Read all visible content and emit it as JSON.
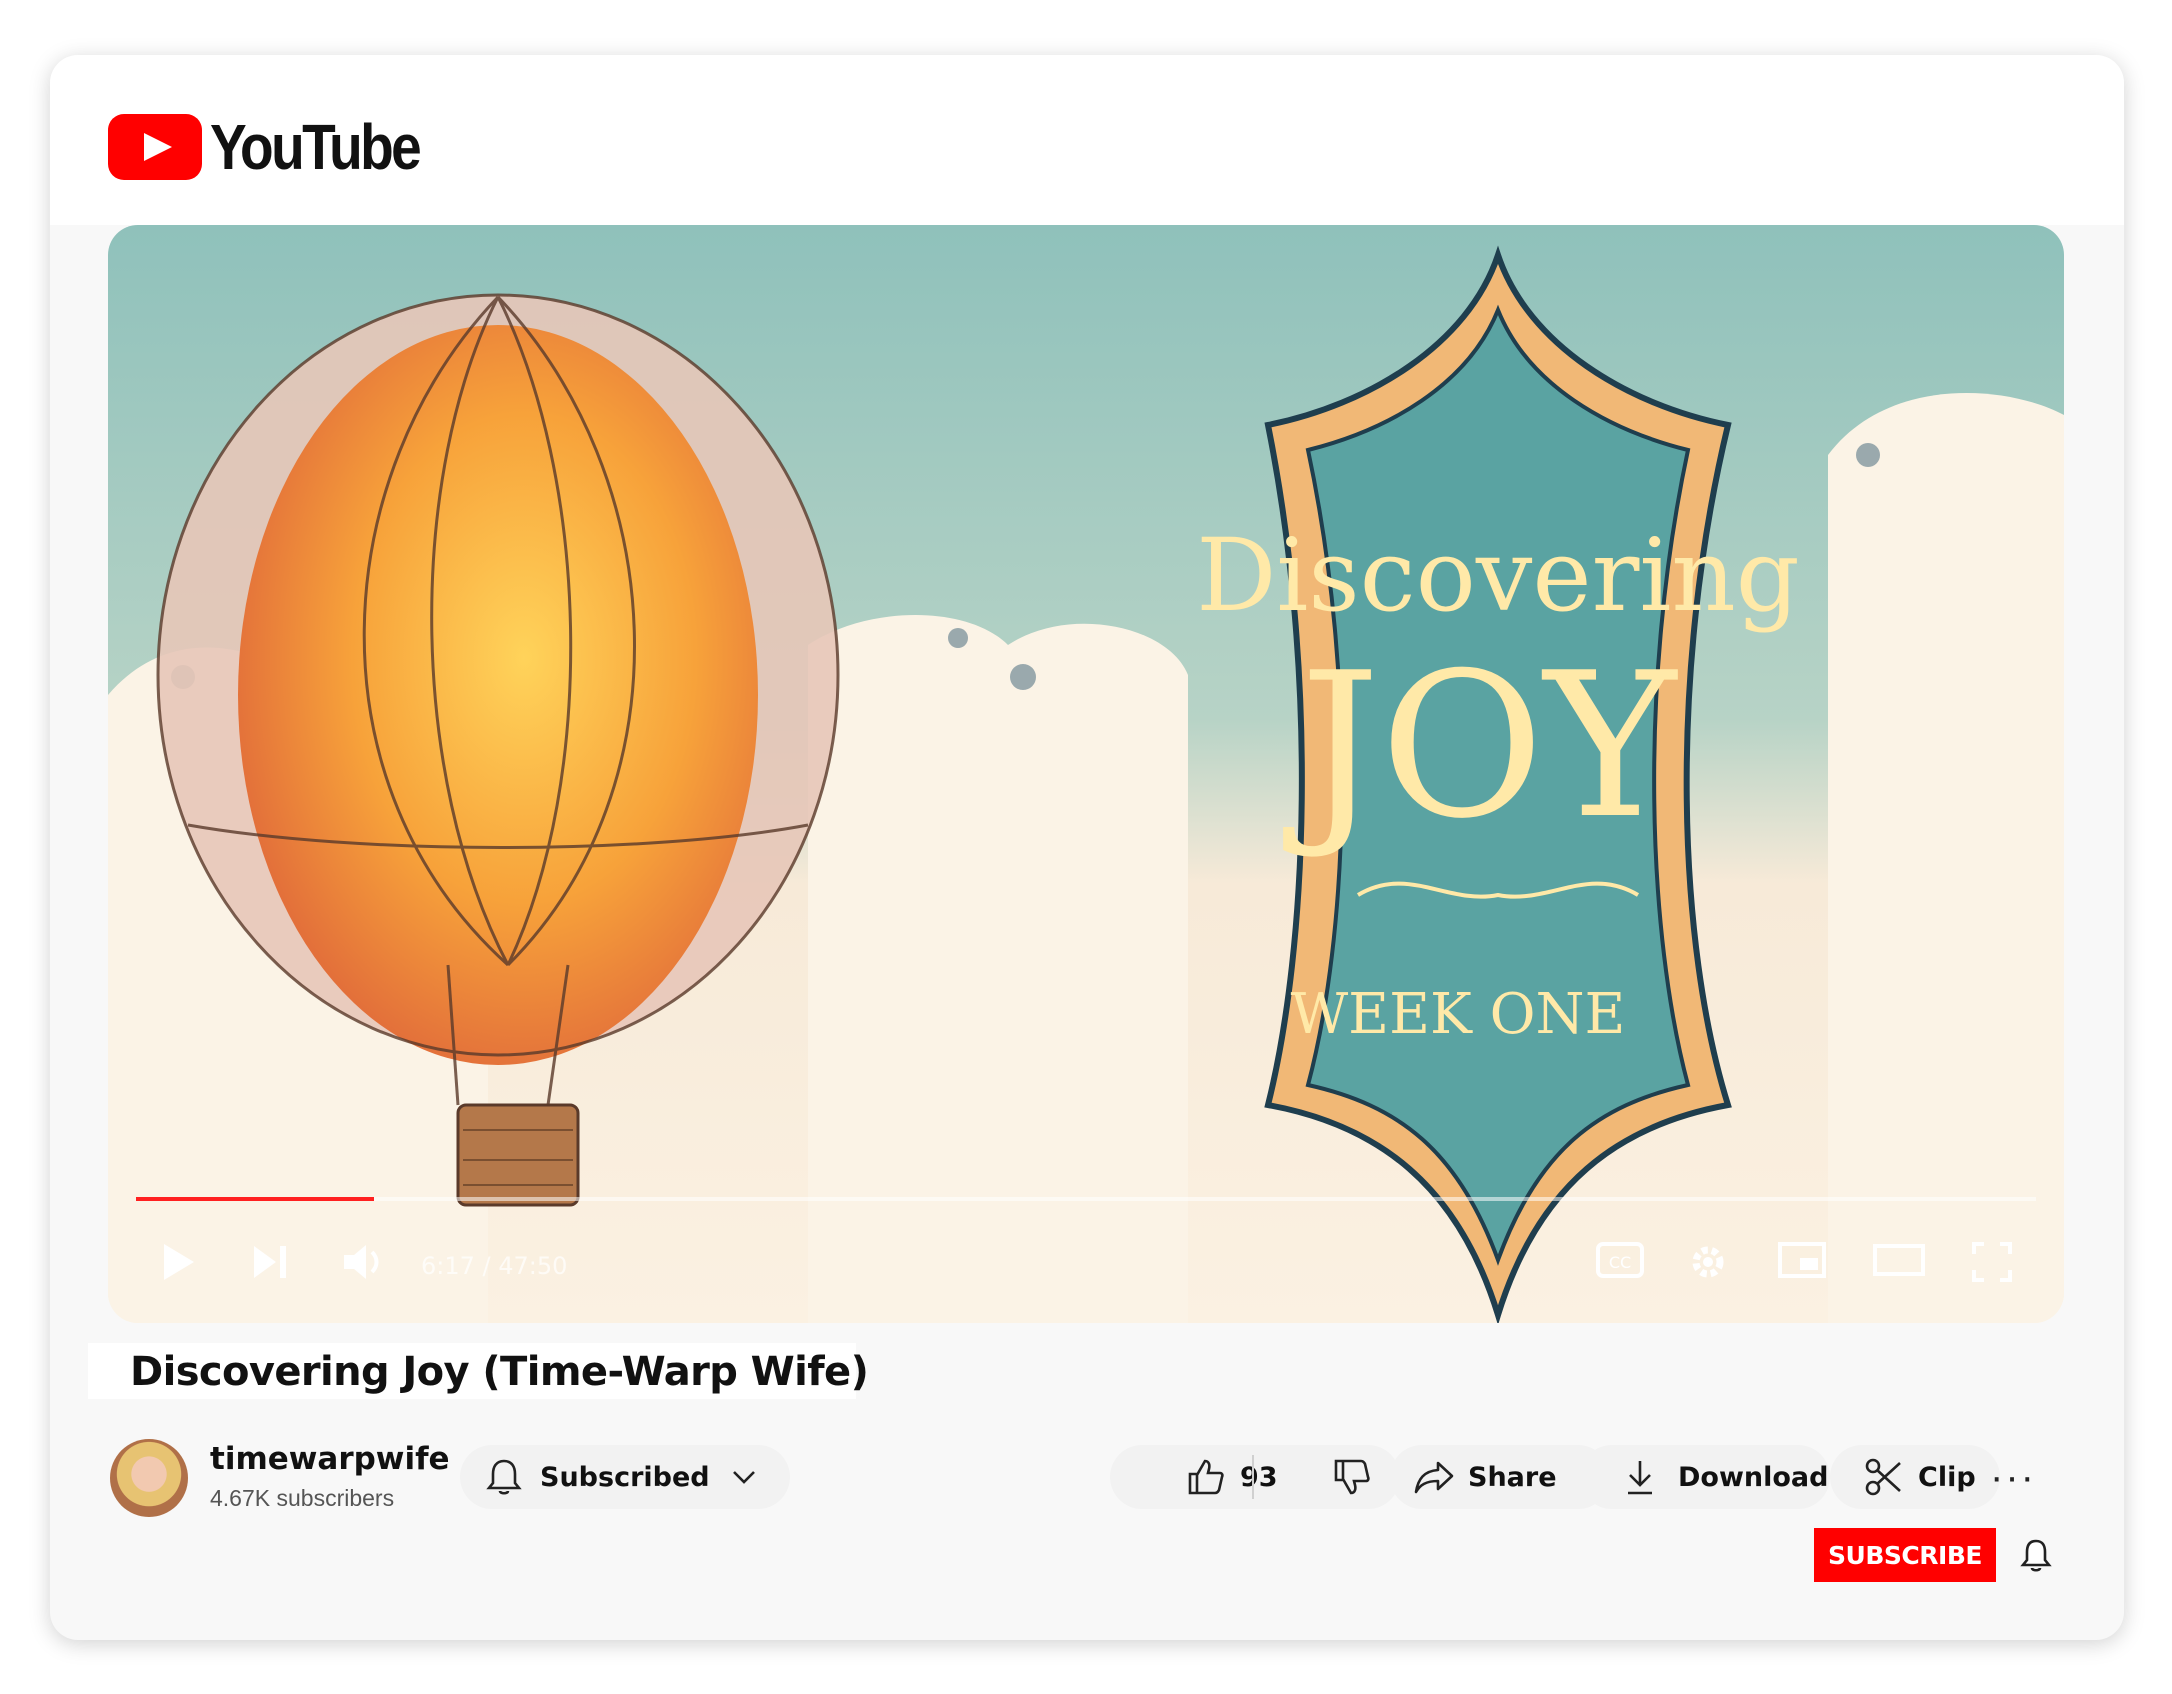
{
  "masthead": {
    "logo_text": "YouTube"
  },
  "player": {
    "thumbnail_text": {
      "line1": "Discovering",
      "line2": "JOY",
      "line3": "WEEK ONE"
    },
    "timecode": "6:17 / 47:50",
    "progress_fraction": 0.125,
    "controls": [
      "play-icon",
      "next-icon",
      "volume-icon",
      "captions-icon",
      "settings-icon",
      "miniplayer-icon",
      "theater-icon",
      "fullscreen-icon"
    ]
  },
  "video": {
    "title": "Discovering Joy (Time-Warp Wife)"
  },
  "channel": {
    "name": "timewarpwife",
    "subscribers": "4.67K subscribers"
  },
  "actions": {
    "subscribed_label": "Subscribed",
    "like_count": "93",
    "share_label": "Share",
    "download_label": "Download",
    "clip_label": "Clip",
    "more_label": "···",
    "subscribe_label": "SUBSCRIBE"
  },
  "colors": {
    "brand": "#ff0000",
    "badge_teal": "#5aa3a2",
    "balloon": "#f29a3c"
  }
}
